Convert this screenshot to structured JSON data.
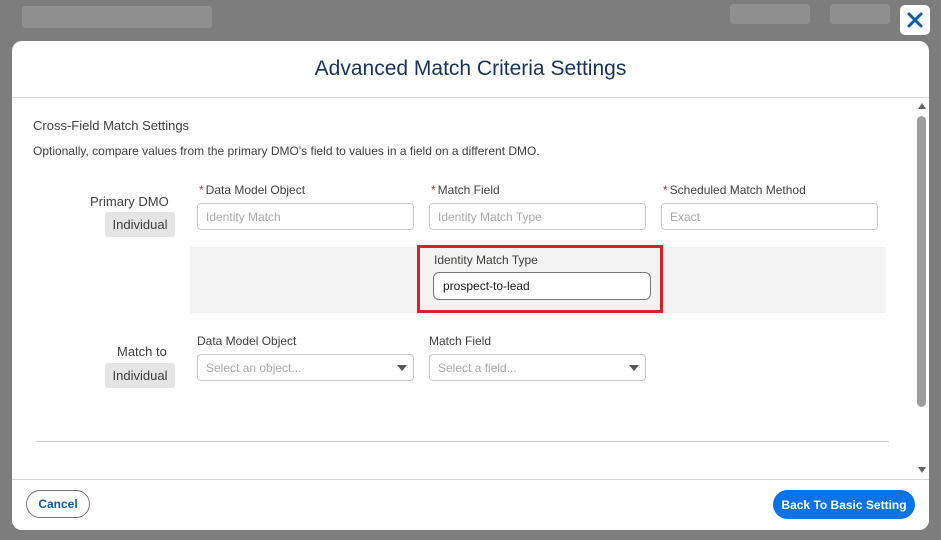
{
  "modal": {
    "title": "Advanced Match Criteria Settings"
  },
  "section": {
    "title": "Cross-Field Match Settings",
    "description": "Optionally, compare values from the primary DMO's field to values in a field on a different DMO."
  },
  "primary": {
    "label": "Primary DMO",
    "pill": "Individual",
    "fields": [
      {
        "label": "Data Model Object",
        "required": "*",
        "placeholder": "Identity Match"
      },
      {
        "label": "Match Field",
        "required": "*",
        "placeholder": "Identity Match Type"
      },
      {
        "label": "Scheduled Match Method",
        "required": "*",
        "placeholder": "Exact"
      }
    ],
    "sub_field": {
      "label": "Identity Match Type",
      "value": "prospect-to-lead"
    }
  },
  "match_to": {
    "label": "Match to",
    "pill": "Individual",
    "fields": [
      {
        "label": "Data Model Object",
        "placeholder": "Select an object..."
      },
      {
        "label": "Match Field",
        "placeholder": "Select a field..."
      }
    ]
  },
  "footer": {
    "cancel_label": "Cancel",
    "back_label": "Back To Basic Setting"
  },
  "colors": {
    "primary_button": "#0b73e8",
    "highlight_border": "#d4232b",
    "title_text": "#16325c",
    "required_marker": "#c23934"
  },
  "icons": {
    "close": "close-icon",
    "dropdown": "chevron-down-icon"
  }
}
